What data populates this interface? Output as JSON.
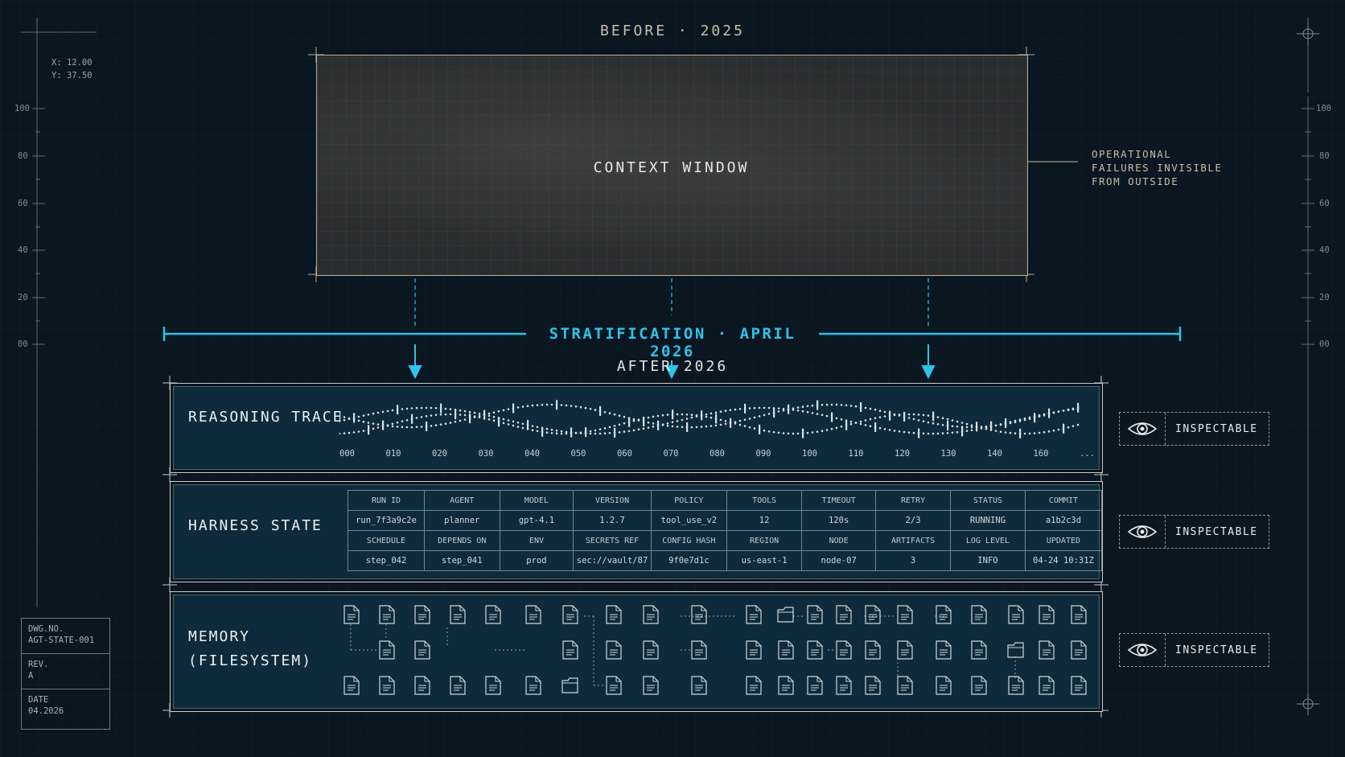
{
  "header": {
    "before_label": "BEFORE · 2025",
    "after_label": "AFTER  2026"
  },
  "context_window": {
    "label": "CONTEXT WINDOW",
    "note": [
      "OPERATIONAL",
      "FAILURES INVISIBLE",
      "FROM OUTSIDE"
    ]
  },
  "stratification": {
    "label": "STRATIFICATION · APRIL 2026"
  },
  "coords": {
    "x": "X: 12.00",
    "y": "Y: 37.50"
  },
  "ruler_labels": [
    "100",
    "80",
    "60",
    "40",
    "20",
    "00"
  ],
  "reasoning_trace": {
    "title": "REASONING TRACE",
    "ticks": [
      "000",
      "010",
      "020",
      "030",
      "040",
      "050",
      "060",
      "070",
      "080",
      "090",
      "100",
      "110",
      "120",
      "130",
      "140",
      "160",
      "..."
    ]
  },
  "harness_state": {
    "title": "HARNESS STATE",
    "rows": [
      [
        "RUN ID",
        "AGENT",
        "MODEL",
        "VERSION",
        "POLICY",
        "TOOLS",
        "TIMEOUT",
        "RETRY",
        "STATUS",
        "COMMIT"
      ],
      [
        "run_7f3a9c2e",
        "planner",
        "gpt-4.1",
        "1.2.7",
        "tool_use_v2",
        "12",
        "120s",
        "2/3",
        "RUNNING",
        "a1b2c3d"
      ],
      [
        "SCHEDULE",
        "DEPENDS ON",
        "ENV",
        "SECRETS REF",
        "CONFIG HASH",
        "REGION",
        "NODE",
        "ARTIFACTS",
        "LOG LEVEL",
        "UPDATED"
      ],
      [
        "step_042",
        "step_041",
        "prod",
        "sec://vault/87",
        "9f0e7d1c",
        "us-east-1",
        "node-07",
        "3",
        "INFO",
        "04-24 10:31Z"
      ]
    ]
  },
  "memory": {
    "title_line1": "MEMORY",
    "title_line2": "(FILESYSTEM)"
  },
  "badges": {
    "inspectable": "INSPECTABLE"
  },
  "drawing_block": {
    "dwg_label": "DWG.NO.",
    "dwg_value": "AGT-STATE-001",
    "rev_label": "REV.",
    "rev_value": "A",
    "date_label": "DATE",
    "date_value": "04.2026"
  },
  "colors": {
    "accent": "#2ec3ea",
    "background": "#0a1620",
    "panel": "#0f2a3a",
    "paper": "#c9bfa8"
  },
  "icons": [
    "eye-icon",
    "file-icon",
    "folder-icon",
    "crosshair-icon"
  ]
}
